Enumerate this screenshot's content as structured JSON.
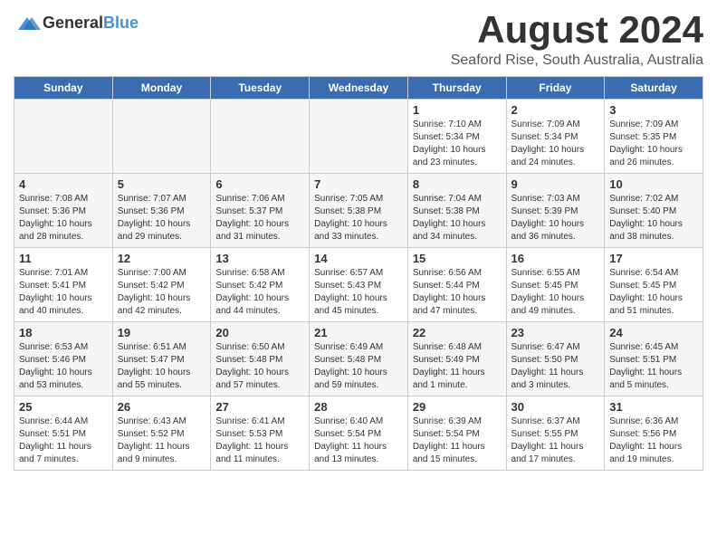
{
  "header": {
    "logo_line1": "General",
    "logo_line2": "Blue",
    "month_year": "August 2024",
    "location": "Seaford Rise, South Australia, Australia"
  },
  "calendar": {
    "days_of_week": [
      "Sunday",
      "Monday",
      "Tuesday",
      "Wednesday",
      "Thursday",
      "Friday",
      "Saturday"
    ],
    "weeks": [
      [
        {
          "day": "",
          "info": ""
        },
        {
          "day": "",
          "info": ""
        },
        {
          "day": "",
          "info": ""
        },
        {
          "day": "",
          "info": ""
        },
        {
          "day": "1",
          "info": "Sunrise: 7:10 AM\nSunset: 5:34 PM\nDaylight: 10 hours\nand 23 minutes."
        },
        {
          "day": "2",
          "info": "Sunrise: 7:09 AM\nSunset: 5:34 PM\nDaylight: 10 hours\nand 24 minutes."
        },
        {
          "day": "3",
          "info": "Sunrise: 7:09 AM\nSunset: 5:35 PM\nDaylight: 10 hours\nand 26 minutes."
        }
      ],
      [
        {
          "day": "4",
          "info": "Sunrise: 7:08 AM\nSunset: 5:36 PM\nDaylight: 10 hours\nand 28 minutes."
        },
        {
          "day": "5",
          "info": "Sunrise: 7:07 AM\nSunset: 5:36 PM\nDaylight: 10 hours\nand 29 minutes."
        },
        {
          "day": "6",
          "info": "Sunrise: 7:06 AM\nSunset: 5:37 PM\nDaylight: 10 hours\nand 31 minutes."
        },
        {
          "day": "7",
          "info": "Sunrise: 7:05 AM\nSunset: 5:38 PM\nDaylight: 10 hours\nand 33 minutes."
        },
        {
          "day": "8",
          "info": "Sunrise: 7:04 AM\nSunset: 5:38 PM\nDaylight: 10 hours\nand 34 minutes."
        },
        {
          "day": "9",
          "info": "Sunrise: 7:03 AM\nSunset: 5:39 PM\nDaylight: 10 hours\nand 36 minutes."
        },
        {
          "day": "10",
          "info": "Sunrise: 7:02 AM\nSunset: 5:40 PM\nDaylight: 10 hours\nand 38 minutes."
        }
      ],
      [
        {
          "day": "11",
          "info": "Sunrise: 7:01 AM\nSunset: 5:41 PM\nDaylight: 10 hours\nand 40 minutes."
        },
        {
          "day": "12",
          "info": "Sunrise: 7:00 AM\nSunset: 5:42 PM\nDaylight: 10 hours\nand 42 minutes."
        },
        {
          "day": "13",
          "info": "Sunrise: 6:58 AM\nSunset: 5:42 PM\nDaylight: 10 hours\nand 44 minutes."
        },
        {
          "day": "14",
          "info": "Sunrise: 6:57 AM\nSunset: 5:43 PM\nDaylight: 10 hours\nand 45 minutes."
        },
        {
          "day": "15",
          "info": "Sunrise: 6:56 AM\nSunset: 5:44 PM\nDaylight: 10 hours\nand 47 minutes."
        },
        {
          "day": "16",
          "info": "Sunrise: 6:55 AM\nSunset: 5:45 PM\nDaylight: 10 hours\nand 49 minutes."
        },
        {
          "day": "17",
          "info": "Sunrise: 6:54 AM\nSunset: 5:45 PM\nDaylight: 10 hours\nand 51 minutes."
        }
      ],
      [
        {
          "day": "18",
          "info": "Sunrise: 6:53 AM\nSunset: 5:46 PM\nDaylight: 10 hours\nand 53 minutes."
        },
        {
          "day": "19",
          "info": "Sunrise: 6:51 AM\nSunset: 5:47 PM\nDaylight: 10 hours\nand 55 minutes."
        },
        {
          "day": "20",
          "info": "Sunrise: 6:50 AM\nSunset: 5:48 PM\nDaylight: 10 hours\nand 57 minutes."
        },
        {
          "day": "21",
          "info": "Sunrise: 6:49 AM\nSunset: 5:48 PM\nDaylight: 10 hours\nand 59 minutes."
        },
        {
          "day": "22",
          "info": "Sunrise: 6:48 AM\nSunset: 5:49 PM\nDaylight: 11 hours\nand 1 minute."
        },
        {
          "day": "23",
          "info": "Sunrise: 6:47 AM\nSunset: 5:50 PM\nDaylight: 11 hours\nand 3 minutes."
        },
        {
          "day": "24",
          "info": "Sunrise: 6:45 AM\nSunset: 5:51 PM\nDaylight: 11 hours\nand 5 minutes."
        }
      ],
      [
        {
          "day": "25",
          "info": "Sunrise: 6:44 AM\nSunset: 5:51 PM\nDaylight: 11 hours\nand 7 minutes."
        },
        {
          "day": "26",
          "info": "Sunrise: 6:43 AM\nSunset: 5:52 PM\nDaylight: 11 hours\nand 9 minutes."
        },
        {
          "day": "27",
          "info": "Sunrise: 6:41 AM\nSunset: 5:53 PM\nDaylight: 11 hours\nand 11 minutes."
        },
        {
          "day": "28",
          "info": "Sunrise: 6:40 AM\nSunset: 5:54 PM\nDaylight: 11 hours\nand 13 minutes."
        },
        {
          "day": "29",
          "info": "Sunrise: 6:39 AM\nSunset: 5:54 PM\nDaylight: 11 hours\nand 15 minutes."
        },
        {
          "day": "30",
          "info": "Sunrise: 6:37 AM\nSunset: 5:55 PM\nDaylight: 11 hours\nand 17 minutes."
        },
        {
          "day": "31",
          "info": "Sunrise: 6:36 AM\nSunset: 5:56 PM\nDaylight: 11 hours\nand 19 minutes."
        }
      ]
    ]
  }
}
